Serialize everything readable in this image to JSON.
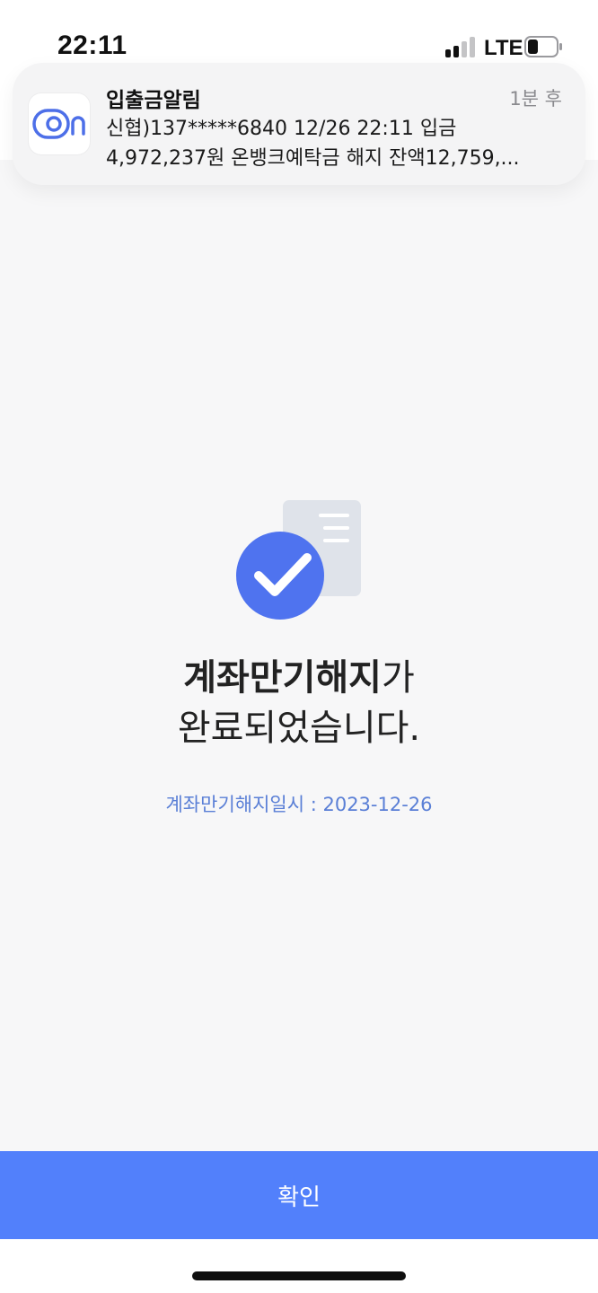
{
  "status_bar": {
    "time": "22:11",
    "network": "LTE"
  },
  "notification": {
    "app_name": "입출금알림",
    "time_ago": "1분 후",
    "line1": "신협)137*****6840 12/26 22:11 입금",
    "line2": "4,972,237원 온뱅크예탁금 해지 잔액12,759,..."
  },
  "main": {
    "headline_strong": "계좌만기해지",
    "headline_suffix": "가",
    "headline_line2": "완료되었습니다.",
    "date_label": "계좌만기해지일시 : 2023-12-26"
  },
  "footer": {
    "confirm_label": "확인"
  },
  "colors": {
    "accent": "#5280fb",
    "check_circle": "#4f73ef",
    "date_text": "#5a7fd6",
    "document": "#dfe3ea"
  },
  "icons": {
    "app": "onbank-logo-icon",
    "illustration": "check-document-icon"
  }
}
